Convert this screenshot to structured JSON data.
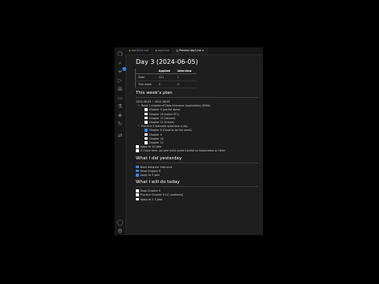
{
  "tabs": [
    {
      "label": "plan2024.md",
      "active": false
    },
    {
      "label": "day3.md",
      "active": false
    },
    {
      "label": "Preview day3.md",
      "active": true
    }
  ],
  "page_title": "Day 3 (2024-06-05)",
  "stats_table": {
    "headers": [
      "",
      "Applied",
      "Interview"
    ],
    "rows": [
      [
        "Total",
        "121",
        "1"
      ],
      [
        "This week",
        "5",
        "0"
      ]
    ]
  },
  "this_week": {
    "heading": "This week's plan",
    "range": "2024-06-03 ~ 2024-06-09",
    "groups": [
      {
        "label": "Read 1 chapter of Data Intensive Applications (DDIA)",
        "items": [
          {
            "label": "Chapter 9 (partial done)",
            "checked": false
          },
          {
            "label": "Chapter 10 (batch ETL)",
            "checked": false
          },
          {
            "label": "Chapter 11 (stream)",
            "checked": false
          },
          {
            "label": "Chapter 12 (future)",
            "checked": false
          }
        ]
      },
      {
        "label": "Practice 5 leetcode questions a day",
        "items": [
          {
            "label": "Chapter 8 (Good to be the week)",
            "checked": true
          },
          {
            "label": "Chapter 9",
            "checked": false
          },
          {
            "label": "Chapter 10",
            "checked": false
          },
          {
            "label": "Chapter 11",
            "checked": false
          }
        ]
      }
    ],
    "extra_items": [
      {
        "label": "Apply to 10 jobs",
        "checked": false
      },
      {
        "label": "If I have time, go over hello world tutorial on Kubernetes or Helm",
        "checked": false
      }
    ]
  },
  "yesterday": {
    "heading": "What I did yesterday",
    "items": [
      {
        "label": "Mock behavior interview",
        "checked": true
      },
      {
        "label": "Read Chapter 9",
        "checked": true
      },
      {
        "label": "Apply to 3 jobs",
        "checked": true
      }
    ]
  },
  "today": {
    "heading": "What I will do today",
    "items": [
      {
        "label": "Read Chapter 9",
        "checked": false
      },
      {
        "label": "Practice Chapter 9 (LC problems)",
        "checked": false
      },
      {
        "label": "Apply to 2-3 jobs",
        "checked": false
      }
    ]
  },
  "activity_icons": [
    "explorer-icon",
    "search-icon",
    "source-control-icon",
    "run-debug-icon",
    "extensions-icon",
    "remote-explorer-icon",
    "testing-icon",
    "docker-icon",
    "git-graph-icon",
    "account-icon",
    "settings-gear-icon"
  ]
}
